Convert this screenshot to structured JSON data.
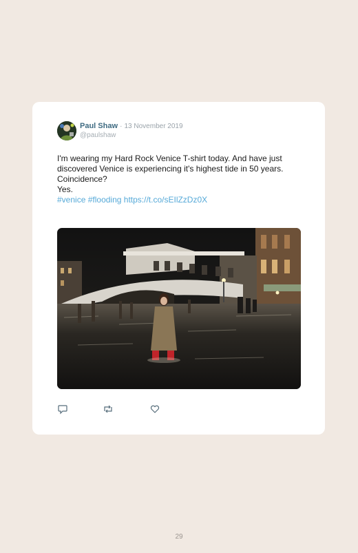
{
  "tweet": {
    "author_name": "Paul Shaw",
    "separator": "·",
    "date": "13 November 2019",
    "handle": "@paulshaw",
    "lines": [
      "I'm wearing my Hard Rock Venice T-shirt today. And have just discovered Venice is experiencing it's highest tide in 50 years.",
      "Coincidence?",
      "Yes."
    ],
    "hashtags": [
      "#venice",
      "#flooding"
    ],
    "link": "https://t.co/sEIlZzDz0X",
    "image_icon": "photo-venice-flood",
    "actions": {
      "reply_icon": "reply-icon",
      "retweet_icon": "retweet-icon",
      "like_icon": "heart-icon"
    }
  },
  "page": {
    "number": "29"
  },
  "colors": {
    "background": "#f1e9e2",
    "card": "#ffffff",
    "name": "#3f6b82",
    "link": "#55a9d8",
    "muted": "#9aa3aa"
  }
}
